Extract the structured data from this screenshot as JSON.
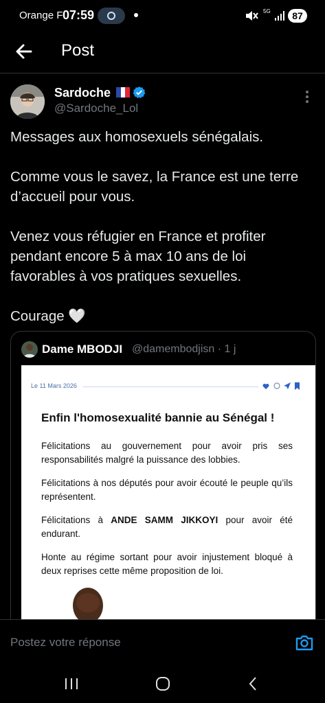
{
  "status_bar": {
    "carrier": "Orange F",
    "time": "07:59",
    "network": "5G",
    "battery": "87"
  },
  "header": {
    "title": "Post"
  },
  "tweet": {
    "author_name": "Sardoche",
    "handle": "@Sardoche_Lol",
    "text": "Messages aux homosexuels sénégalais.\n\nComme vous le savez, la France est une terre d’accueil pour vous.\n\nVenez vous réfugier en France et profiter pendant encore 5 à max 10 ans de loi favorables à vos pratiques sexuelles.\n\nCourage 🤍",
    "quote": {
      "author_name": "Dame MBODJI",
      "handle": "@damembodjisn · 1 j",
      "document": {
        "date": "Le 11 Mars 2026",
        "title": "Enfin l'homosexualité bannie au Sénégal !",
        "paragraphs": [
          "Félicitations au gouvernement pour avoir pris ses responsabilités malgré la puissance des lobbies.",
          "Félicitations à nos députés pour avoir écouté le peuple qu’ils représentent.",
          "Félicitations à ANDE SAMM JIKKOYI pour avoir été endurant.",
          "Honte au régime sortant pour avoir injustement bloqué à deux reprises cette même proposition de loi."
        ]
      }
    }
  },
  "reply": {
    "placeholder": "Postez votre réponse"
  },
  "colors": {
    "background": "#000000",
    "text": "#e7e9ea",
    "secondary_text": "#71767b",
    "accent": "#1d9bf0",
    "divider": "#2f3336"
  },
  "icons": {
    "back": "arrow-left-icon",
    "verified": "verified-badge-icon",
    "more": "more-vertical-icon",
    "camera": "camera-icon",
    "nav_recents": "recents-icon",
    "nav_home": "home-circle-icon",
    "nav_back": "chevron-left-icon"
  }
}
